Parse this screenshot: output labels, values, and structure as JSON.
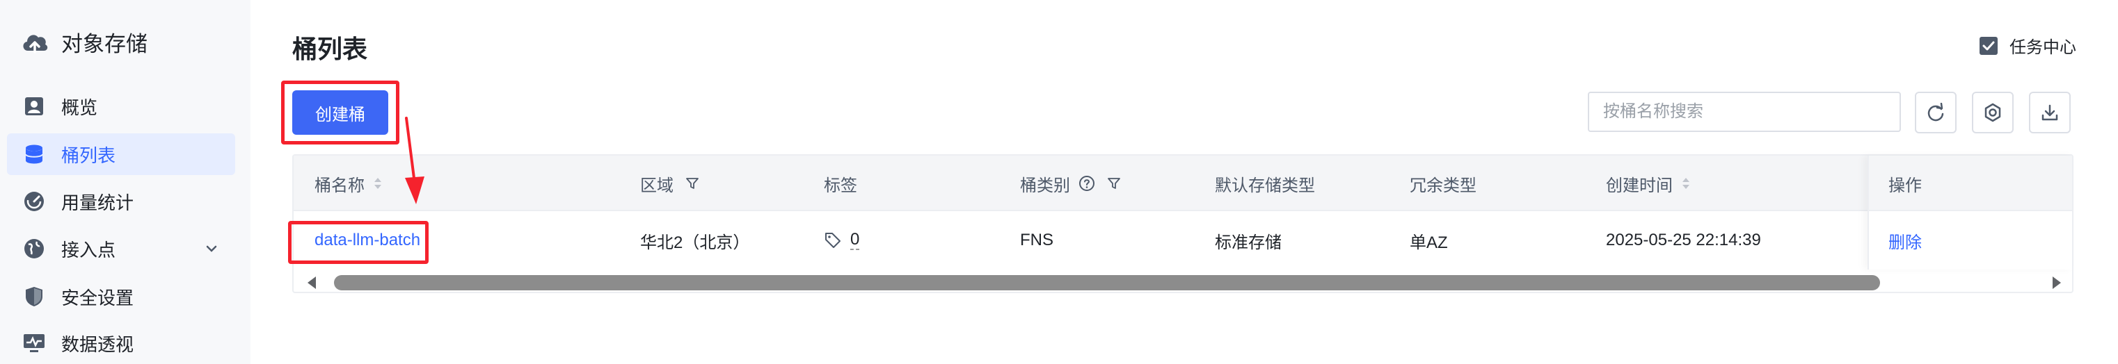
{
  "sidebar": {
    "brand": "对象存储",
    "items": [
      {
        "label": "概览",
        "icon": "person-card-icon"
      },
      {
        "label": "桶列表",
        "icon": "database-icon",
        "active": true
      },
      {
        "label": "用量统计",
        "icon": "gauge-icon"
      },
      {
        "label": "接入点",
        "icon": "globe-icon",
        "expandable": true
      },
      {
        "label": "安全设置",
        "icon": "shield-icon"
      },
      {
        "label": "数据透视",
        "icon": "monitor-chart-icon"
      }
    ]
  },
  "header": {
    "title": "桶列表",
    "task_center": "任务中心"
  },
  "toolbar": {
    "create_label": "创建桶",
    "search_placeholder": "按桶名称搜索"
  },
  "table": {
    "columns": [
      "桶名称",
      "区域",
      "标签",
      "桶类别",
      "默认存储类型",
      "冗余类型",
      "创建时间",
      "操作"
    ],
    "rows": [
      {
        "name": "data-llm-batch",
        "region": "华北2（北京）",
        "tags": "0",
        "category": "FNS",
        "storage_type": "标准存储",
        "redundancy": "单AZ",
        "created": "2025-05-25 22:14:39",
        "action": "删除"
      }
    ]
  },
  "colors": {
    "accent": "#3d67f5",
    "link": "#3366ff",
    "highlight": "#f5222d",
    "sidebar_bg": "#f7f8fa"
  }
}
